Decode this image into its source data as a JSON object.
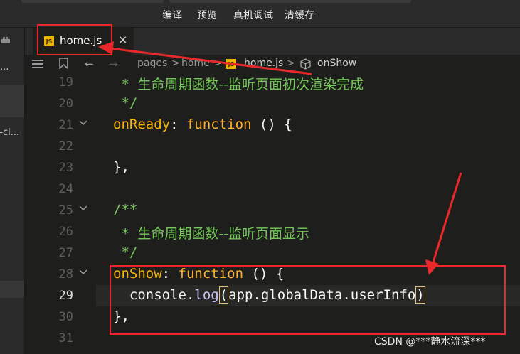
{
  "toolbar": {
    "buttons": [
      "编译",
      "预览",
      "真机调试",
      "清缓存"
    ]
  },
  "left_panel": {
    "fragments": [
      "...",
      "v-cl..."
    ]
  },
  "tabs": [
    {
      "icon": "JS",
      "label": "home.js",
      "close": "×"
    }
  ],
  "breadcrumb": {
    "items": [
      "pages",
      "home",
      "home.js",
      "onShow"
    ],
    "separator": ">"
  },
  "editor": {
    "line_numbers": [
      "19",
      "20",
      "21",
      "22",
      "23",
      "24",
      "25",
      "26",
      "27",
      "28",
      "29",
      "30",
      "31"
    ],
    "active_line": "29",
    "lines": [
      {
        "no": "19",
        "parts": [
          {
            "t": " * ",
            "c": "comment-star"
          },
          {
            "t": "生命周期函数--监听页面初次渲染完成",
            "c": "comment"
          }
        ]
      },
      {
        "no": "20",
        "parts": [
          {
            "t": " */",
            "c": "comment-star"
          }
        ]
      },
      {
        "no": "21",
        "parts": [
          {
            "t": "onReady",
            "c": "fn"
          },
          {
            "t": ": ",
            "c": ""
          },
          {
            "t": "function",
            "c": "kw"
          },
          {
            "t": " () {",
            "c": ""
          }
        ]
      },
      {
        "no": "22",
        "parts": []
      },
      {
        "no": "23",
        "parts": [
          {
            "t": "},",
            "c": ""
          }
        ]
      },
      {
        "no": "24",
        "parts": []
      },
      {
        "no": "25",
        "parts": [
          {
            "t": "/**",
            "c": "comment-star"
          }
        ]
      },
      {
        "no": "26",
        "parts": [
          {
            "t": " * ",
            "c": "comment-star"
          },
          {
            "t": "生命周期函数--监听页面显示",
            "c": "comment"
          }
        ]
      },
      {
        "no": "27",
        "parts": [
          {
            "t": " */",
            "c": "comment-star"
          }
        ]
      },
      {
        "no": "28",
        "parts": [
          {
            "t": "onShow",
            "c": "fn"
          },
          {
            "t": ": ",
            "c": ""
          },
          {
            "t": "function",
            "c": "kw"
          },
          {
            "t": " () {",
            "c": ""
          }
        ]
      },
      {
        "no": "29",
        "parts": [
          {
            "t": "  console.",
            "c": ""
          },
          {
            "t": "log",
            "c": "builtin"
          },
          {
            "t": "(",
            "c": "paren-match"
          },
          {
            "t": "app.globalData.userInfo",
            "c": ""
          },
          {
            "t": ")",
            "c": "paren-match"
          }
        ]
      },
      {
        "no": "30",
        "parts": [
          {
            "t": "},",
            "c": ""
          }
        ]
      },
      {
        "no": "31",
        "parts": []
      }
    ]
  },
  "watermark": "CSDN @***静水流深***",
  "colors": {
    "annotation_red": "#e8282a",
    "comment_green": "#75c85a",
    "keyword_orange": "#ffb02e"
  }
}
